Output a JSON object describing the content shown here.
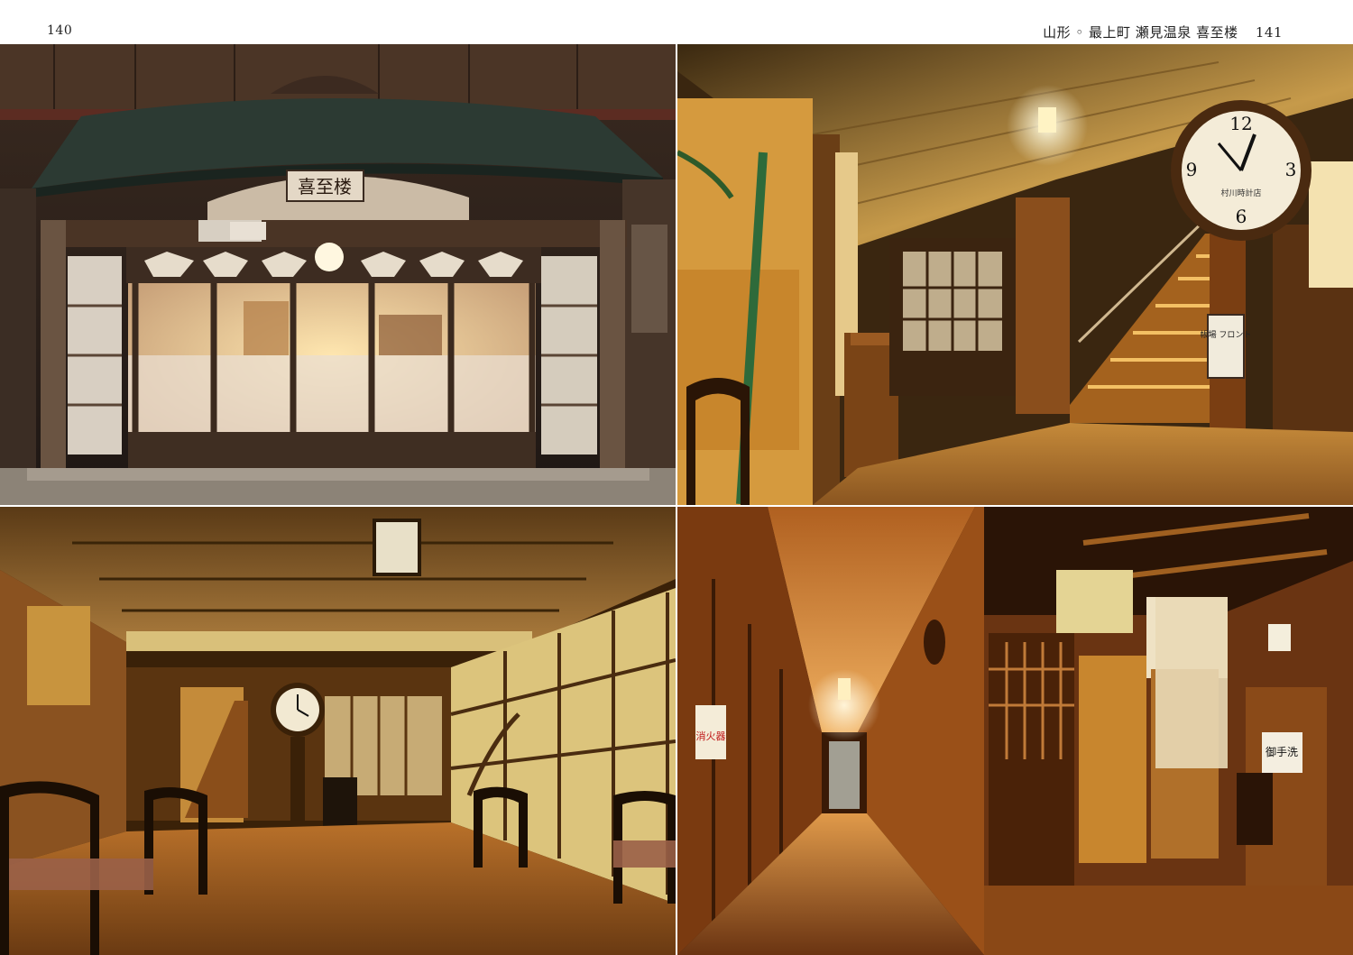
{
  "page_left": {
    "number": "140"
  },
  "page_right": {
    "number": "141",
    "running_head": "山形 ◦ 最上町 瀬見温泉 喜至楼"
  },
  "photos": {
    "entrance": {
      "signboard": "喜至楼",
      "small_sign": "",
      "colors": {
        "wood": "#5a3a24",
        "roof": "#2c3a33",
        "glow": "#f4d59a"
      }
    },
    "lobby_clock": {
      "clock_label": "村川時計店",
      "front_sign": "帳場 フロント",
      "colors": {
        "wood": "#7a4a1c",
        "glow": "#f5c264"
      }
    },
    "hall": {
      "colors": {
        "wood": "#5b3414",
        "glow": "#e9b455"
      }
    },
    "corridor": {
      "fire_label": "消火器",
      "toilet_label": "御手洗",
      "colors": {
        "wood": "#6a3412",
        "glow": "#f29a3a"
      }
    }
  }
}
